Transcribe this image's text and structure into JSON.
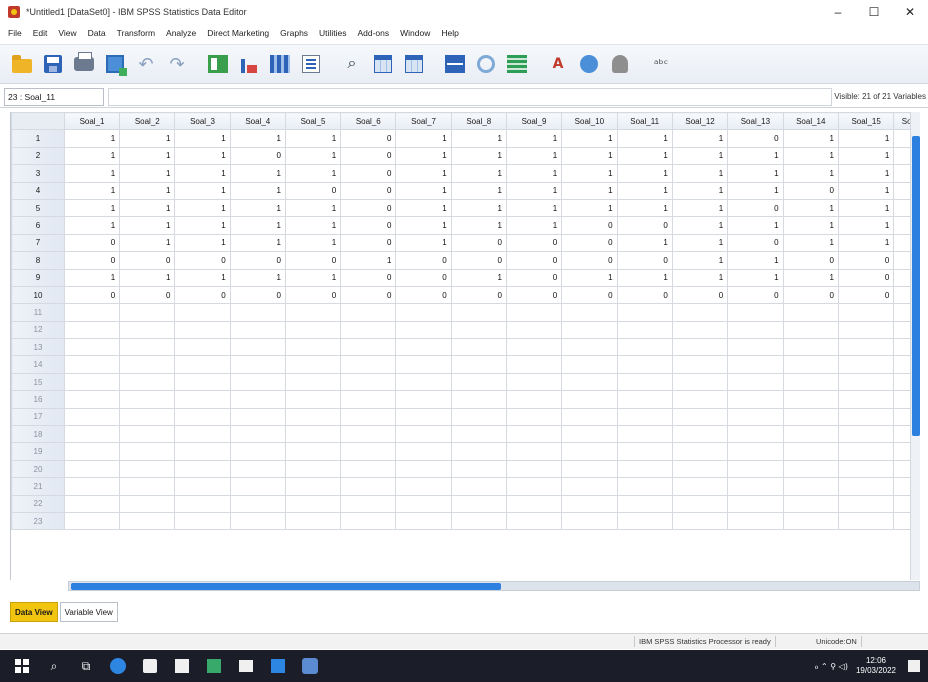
{
  "window": {
    "title": "*Untitled1 [DataSet0] - IBM SPSS Statistics Data Editor",
    "controls": [
      "–",
      "☐",
      "✕"
    ]
  },
  "menu": [
    "File",
    "Edit",
    "View",
    "Data",
    "Transform",
    "Analyze",
    "Direct Marketing",
    "Graphs",
    "Utilities",
    "Add-ons",
    "Window",
    "Help"
  ],
  "cell_editor": {
    "reference": "23 : Soal_11",
    "value": "",
    "visible_info": "Visible: 21 of 21 Variables"
  },
  "columns": [
    "Soal_1",
    "Soal_2",
    "Soal_3",
    "Soal_4",
    "Soal_5",
    "Soal_6",
    "Soal_7",
    "Soal_8",
    "Soal_9",
    "Soal_10",
    "Soal_11",
    "Soal_12",
    "Soal_13",
    "Soal_14",
    "Soal_15",
    "So"
  ],
  "rows": [
    {
      "n": "1",
      "cells": [
        "1",
        "1",
        "1",
        "1",
        "1",
        "0",
        "1",
        "1",
        "1",
        "1",
        "1",
        "1",
        "0",
        "1",
        "1",
        ""
      ]
    },
    {
      "n": "2",
      "cells": [
        "1",
        "1",
        "1",
        "0",
        "1",
        "0",
        "1",
        "1",
        "1",
        "1",
        "1",
        "1",
        "1",
        "1",
        "1",
        ""
      ]
    },
    {
      "n": "3",
      "cells": [
        "1",
        "1",
        "1",
        "1",
        "1",
        "0",
        "1",
        "1",
        "1",
        "1",
        "1",
        "1",
        "1",
        "1",
        "1",
        ""
      ]
    },
    {
      "n": "4",
      "cells": [
        "1",
        "1",
        "1",
        "1",
        "0",
        "0",
        "1",
        "1",
        "1",
        "1",
        "1",
        "1",
        "1",
        "0",
        "1",
        ""
      ]
    },
    {
      "n": "5",
      "cells": [
        "1",
        "1",
        "1",
        "1",
        "1",
        "0",
        "1",
        "1",
        "1",
        "1",
        "1",
        "1",
        "0",
        "1",
        "1",
        ""
      ]
    },
    {
      "n": "6",
      "cells": [
        "1",
        "1",
        "1",
        "1",
        "1",
        "0",
        "1",
        "1",
        "1",
        "0",
        "0",
        "1",
        "1",
        "1",
        "1",
        ""
      ]
    },
    {
      "n": "7",
      "cells": [
        "0",
        "1",
        "1",
        "1",
        "1",
        "0",
        "1",
        "0",
        "0",
        "0",
        "1",
        "1",
        "0",
        "1",
        "1",
        ""
      ]
    },
    {
      "n": "8",
      "cells": [
        "0",
        "0",
        "0",
        "0",
        "0",
        "1",
        "0",
        "0",
        "0",
        "0",
        "0",
        "1",
        "1",
        "0",
        "0",
        ""
      ]
    },
    {
      "n": "9",
      "cells": [
        "1",
        "1",
        "1",
        "1",
        "1",
        "0",
        "0",
        "1",
        "0",
        "1",
        "1",
        "1",
        "1",
        "1",
        "0",
        ""
      ]
    },
    {
      "n": "10",
      "cells": [
        "0",
        "0",
        "0",
        "0",
        "0",
        "0",
        "0",
        "0",
        "0",
        "0",
        "0",
        "0",
        "0",
        "0",
        "0",
        ""
      ]
    },
    {
      "n": "11",
      "cells": []
    },
    {
      "n": "12",
      "cells": []
    },
    {
      "n": "13",
      "cells": []
    },
    {
      "n": "14",
      "cells": []
    },
    {
      "n": "15",
      "cells": []
    },
    {
      "n": "16",
      "cells": []
    },
    {
      "n": "17",
      "cells": []
    },
    {
      "n": "18",
      "cells": []
    },
    {
      "n": "19",
      "cells": []
    },
    {
      "n": "20",
      "cells": []
    },
    {
      "n": "21",
      "cells": []
    },
    {
      "n": "22",
      "cells": []
    },
    {
      "n": "23",
      "cells": []
    }
  ],
  "tabs": {
    "data_view": "Data View",
    "variable_view": "Variable View"
  },
  "status": {
    "processor": "IBM SPSS Statistics Processor is ready",
    "unicode": "Unicode:ON"
  },
  "taskbar": {
    "time": "12:06",
    "date": "19/03/2022"
  },
  "colors": {
    "scroll_accent": "#2d7fe0",
    "active_tab": "#f1c40f",
    "taskbar": "#1b1d29"
  }
}
